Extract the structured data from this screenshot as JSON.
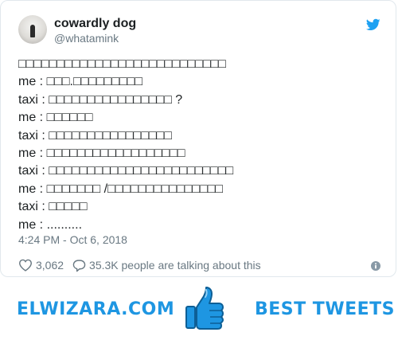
{
  "tweet": {
    "display_name": "cowardly dog",
    "handle": "@whatamink",
    "lines": [
      "□□□□□□□□□□□□□□□□□□□□□□□□□□□",
      "me : □□□.□□□□□□□□□",
      "taxi : □□□□□□□□□□□□□□□□ ?",
      "me : □□□□□□",
      "taxi : □□□□□□□□□□□□□□□□",
      "me : □□□□□□□□□□□□□□□□□□",
      "taxi : □□□□□□□□□□□□□□□□□□□□□□□□",
      "me : □□□□□□□ /□□□□□□□□□□□□□□□",
      "taxi : □□□□□",
      "me : .........."
    ],
    "timestamp": "4:24 PM - Oct 6, 2018",
    "like_count": "3,062",
    "talk_text": "35.3K people are talking about this"
  },
  "icons": {
    "avatar": "avatar-photo",
    "brand": "twitter-bird-icon",
    "like": "heart-icon",
    "reply": "speech-bubble-icon",
    "info": "info-icon",
    "thumb": "thumbs-up-icon"
  },
  "footer": {
    "site_name": "ELWIZARA.COM",
    "slogan": "BEST TWEETS"
  },
  "colors": {
    "brand_blue": "#1da1f2",
    "footer_blue": "#1e96e2",
    "text_primary": "#1c2022",
    "text_secondary": "#697882",
    "border": "#e1e8ed"
  }
}
